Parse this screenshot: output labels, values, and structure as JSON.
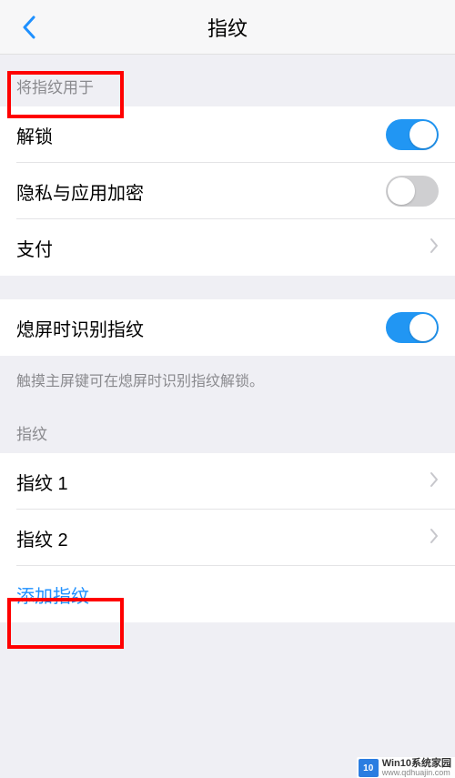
{
  "nav": {
    "title": "指纹"
  },
  "section1": {
    "header": "将指纹用于",
    "rows": {
      "unlock": {
        "label": "解锁",
        "on": true
      },
      "privacy": {
        "label": "隐私与应用加密",
        "on": false
      },
      "pay": {
        "label": "支付"
      }
    }
  },
  "section2": {
    "rows": {
      "screenoff": {
        "label": "熄屏时识别指纹",
        "on": true
      }
    },
    "hint": "触摸主屏键可在熄屏时识别指纹解锁。"
  },
  "section3": {
    "header": "指纹",
    "rows": {
      "fp1": {
        "label": "指纹 1"
      },
      "fp2": {
        "label": "指纹 2"
      },
      "add": {
        "label": "添加指纹"
      }
    }
  },
  "watermark": {
    "logo": "10",
    "line1": "Win10系统家园",
    "line2": "www.qdhuajin.com"
  }
}
